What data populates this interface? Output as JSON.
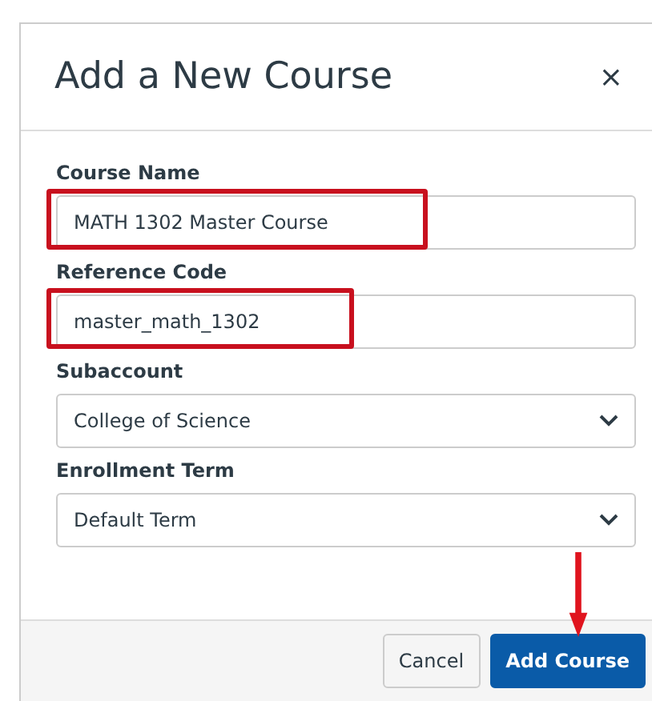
{
  "dialog": {
    "title": "Add a New Course",
    "close": "×"
  },
  "fields": [
    {
      "kind": "text",
      "label": "Course Name",
      "value": "MATH 1302 Master Course",
      "highlighted": true
    },
    {
      "kind": "text",
      "label": "Reference Code",
      "value": "master_math_1302",
      "highlighted": true
    },
    {
      "kind": "select",
      "label": "Subaccount",
      "value": "College of Science",
      "highlighted": false
    },
    {
      "kind": "select",
      "label": "Enrollment Term",
      "value": "Default Term",
      "highlighted": false
    }
  ],
  "buttons": [
    {
      "label": "Cancel",
      "kind": "secondary",
      "arrow": false
    },
    {
      "label": "Add Course",
      "kind": "primary",
      "arrow": true
    }
  ]
}
